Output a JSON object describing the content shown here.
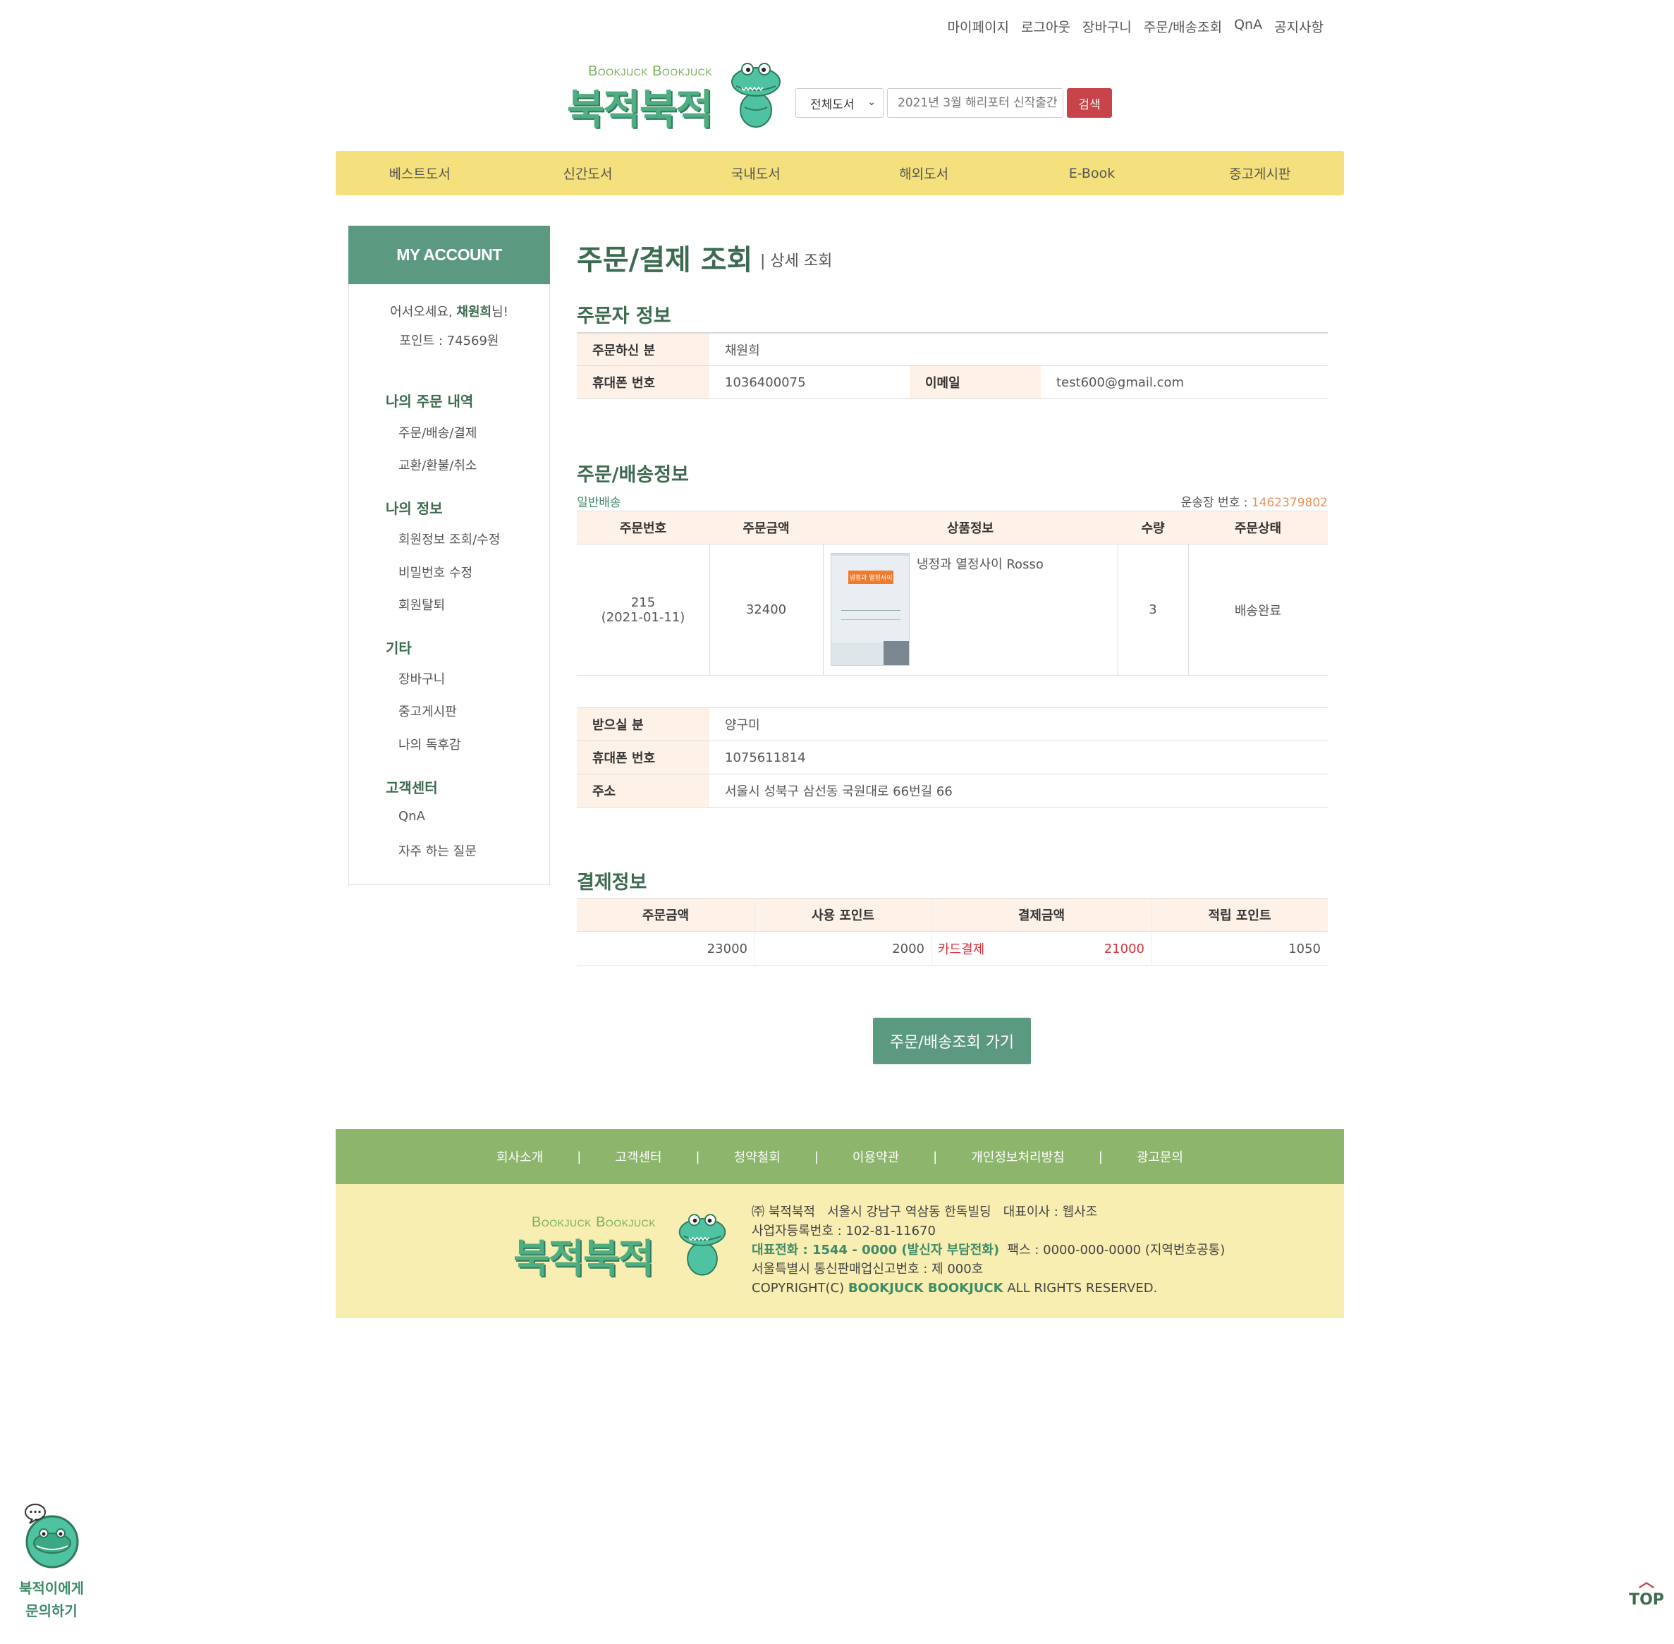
{
  "top_links": [
    "마이페이지",
    "로그아웃",
    "장바구니",
    "주문/배송조회",
    "QnA",
    "공지사항"
  ],
  "logo": {
    "en": "Bookjuck Bookjuck",
    "kr": "북적북적"
  },
  "search": {
    "category": "전체도서",
    "placeholder": "2021년 3월 해리포터 신작출간",
    "button": "검색"
  },
  "nav": [
    "베스트도서",
    "신간도서",
    "국내도서",
    "해외도서",
    "E-Book",
    "중고게시판"
  ],
  "sidebar": {
    "title": "MY ACCOUNT",
    "greeting_prefix": "어서오세요, ",
    "user_name": "채원희",
    "greeting_suffix": "님!",
    "points": "포인트 : 74569원",
    "sections": [
      {
        "title": "나의 주문 내역",
        "items": [
          "주문/배송/결제",
          "교환/환불/취소"
        ]
      },
      {
        "title": "나의 정보",
        "items": [
          "회원정보 조회/수정",
          "비밀번호 수정",
          "회원탈퇴"
        ]
      },
      {
        "title": "기타",
        "items": [
          "장바구니",
          "중고게시판",
          "나의 독후감"
        ]
      },
      {
        "title": "고객센터",
        "items": [
          "QnA",
          "자주 하는 질문"
        ]
      }
    ]
  },
  "page": {
    "title": "주문/결제 조회",
    "subtitle": "| 상세 조회"
  },
  "orderer": {
    "section_title": "주문자 정보",
    "name_label": "주문하신 분",
    "name_value": "채원희",
    "phone_label": "휴대폰 번호",
    "phone_value": "1036400075",
    "email_label": "이메일",
    "email_value": "test600@gmail.com"
  },
  "shipping": {
    "section_title": "주문/배송정보",
    "delivery_type": "일반배송",
    "tracking_label": "운송장 번호 : ",
    "tracking_number": "1462379802",
    "headers": [
      "주문번호",
      "주문금액",
      "상품정보",
      "수량",
      "주문상태"
    ],
    "order": {
      "number": "215",
      "date": "(2021-01-11)",
      "amount": "32400",
      "product": "냉정과 열정사이 Rosso",
      "cover_title": "냉정과 열정사이",
      "quantity": "3",
      "status": "배송완료"
    },
    "recipient_label": "받으실 분",
    "recipient_value": "양구미",
    "phone_label": "휴대폰 번호",
    "phone_value": "1075611814",
    "address_label": "주소",
    "address_value": "서울시 성북구 삼선동 국원대로 66번길 66"
  },
  "payment": {
    "section_title": "결제정보",
    "headers": [
      "주문금액",
      "사용 포인트",
      "결제금액",
      "적립 포인트"
    ],
    "order_amount": "23000",
    "used_points": "2000",
    "method": "카드결제",
    "paid_amount": "21000",
    "earned_points": "1050"
  },
  "go_button": "주문/배송조회 가기",
  "footer": {
    "links": [
      "회사소개",
      "고객센터",
      "청약철회",
      "이용약관",
      "개인정보처리방침",
      "광고문의"
    ],
    "separator": "|",
    "line1": "㈜ 북적북적   서울시 강남구 역삼동 한독빌딩   대표이사 : 웹사조",
    "line2": "사업자등록번호 : 102-81-11670",
    "line3_hl": "대표전화 : 1544 - 0000 (발신자 부담전화)",
    "line3_rest": "  팩스 : 0000-000-0000 (지역번호공통)",
    "line4": "서울특별시 통신판매업신고번호 : 제 000호",
    "line5_pre": "COPYRIGHT(C) ",
    "line5_brand": "BOOKJUCK BOOKJUCK",
    "line5_post": " ALL RIGHTS RESERVED."
  },
  "chat": {
    "line1": "북적이에게",
    "line2": "문의하기",
    "bubble": "..."
  },
  "top_button": "TOP",
  "colors": {
    "brand_green": "#5b9a80",
    "nav_yellow": "#f4e07c",
    "footer_green": "#8db66c",
    "footer_yellow": "#f8eeb1",
    "search_red": "#c9434b",
    "label_bg": "#fdf1e8",
    "tracking_orange": "#e9905a",
    "pay_red": "#d9333f"
  }
}
